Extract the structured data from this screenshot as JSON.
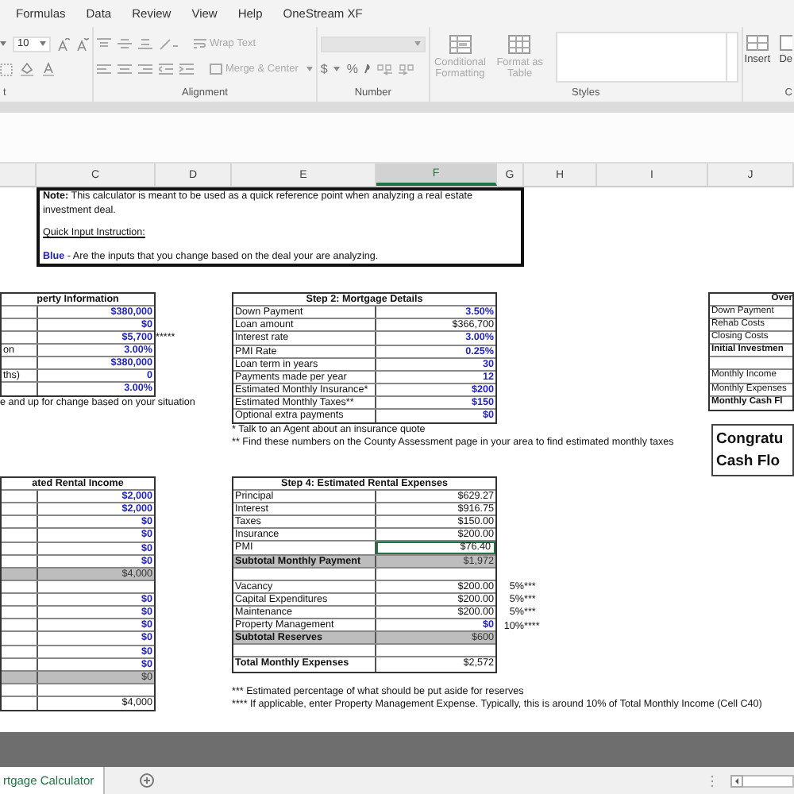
{
  "ribbon": {
    "tabs": [
      {
        "label": "Formulas",
        "selected": false
      },
      {
        "label": "Data",
        "selected": false
      },
      {
        "label": "Review",
        "selected": false
      },
      {
        "label": "View",
        "selected": false
      },
      {
        "label": "Help",
        "selected": false
      },
      {
        "label": "OneStream XF",
        "selected": false
      }
    ],
    "font_size": "10",
    "wrap_text": "Wrap Text",
    "merge_center": "Merge & Center",
    "currency": "$",
    "percent": "%",
    "conditional_formatting": "Conditional Formatting",
    "format_as_table": "Format as Table",
    "insert": "Insert",
    "delete": "De",
    "groups": [
      "t",
      "Alignment",
      "Number",
      "Styles",
      "C"
    ]
  },
  "columns": [
    {
      "letter": "C",
      "selected": false
    },
    {
      "letter": "D",
      "selected": false
    },
    {
      "letter": "E",
      "selected": false
    },
    {
      "letter": "F",
      "selected": true
    },
    {
      "letter": "G",
      "selected": false
    },
    {
      "letter": "H",
      "selected": false
    },
    {
      "letter": "I",
      "selected": false
    },
    {
      "letter": "J",
      "selected": false
    }
  ],
  "note": {
    "text": "**Note:** This calculator is meant to be used as a quick reference point when analyzing a real estate investment deal.",
    "instruction_title": "Quick Input Instruction:",
    "instruction": "**Blue** - Are the inputs that you change based on the deal your are analyzing."
  },
  "property": {
    "title": "perty Information",
    "rows": [
      {
        "value": "$380,000",
        "input": true
      },
      {
        "value": "$0",
        "input": true
      },
      {
        "value": "$5,700",
        "input": true,
        "mark": "*****"
      },
      {
        "label": "on",
        "value": "3.00%",
        "input": true
      },
      {
        "value": "$380,000",
        "input": true
      },
      {
        "label": "ths)",
        "value": "0",
        "input": true
      },
      {
        "value": "3.00%",
        "input": true
      }
    ],
    "footer": "e and up for change based on your situation"
  },
  "mortgage": {
    "title": "Step 2: Mortgage Details",
    "rows": [
      {
        "label": "Down Payment",
        "value": "3.50%",
        "input": true
      },
      {
        "label": "Loan amount",
        "value": "$366,700",
        "input": false
      },
      {
        "label": "Interest rate",
        "value": "3.00%",
        "input": true
      },
      {
        "label": "PMI Rate",
        "value": "0.25%",
        "input": true
      },
      {
        "label": "Loan term in years",
        "value": "30",
        "input": true
      },
      {
        "label": "Payments made per year",
        "value": "12",
        "input": true
      },
      {
        "label": "Estimated Monthly Insurance*",
        "value": "$200",
        "input": true
      },
      {
        "label": "Estimated Monthly Taxes**",
        "value": "$150",
        "input": true
      },
      {
        "label": "Optional extra payments",
        "value": "$0",
        "input": true
      }
    ],
    "notes": [
      "* Talk to an Agent about an insurance quote",
      "** Find these numbers on the County Assessment page in your area to find estimated monthly taxes"
    ]
  },
  "overview": {
    "title": "Over",
    "rows": [
      {
        "label": "Down Payment",
        "bold": false
      },
      {
        "label": "Rehab Costs",
        "bold": false
      },
      {
        "label": "Closing Costs",
        "bold": false
      },
      {
        "label": "Initial Investmen",
        "bold": true
      },
      {},
      {
        "label": "Monthly Income",
        "bold": false
      },
      {
        "label": "Monthly Expenses",
        "bold": false
      },
      {
        "label": "Monthly Cash Fl",
        "bold": true
      }
    ]
  },
  "cash_flow": [
    "Congratu",
    "Cash Flo"
  ],
  "income": {
    "title": "ated Rental Income",
    "rows": [
      {
        "kind": "input",
        "value": "$2,000"
      },
      {
        "kind": "input",
        "value": "$2,000"
      },
      {
        "kind": "input",
        "value": "$0"
      },
      {
        "kind": "input",
        "value": "$0"
      },
      {
        "kind": "input",
        "value": "$0"
      },
      {
        "kind": "input",
        "value": "$0"
      },
      {
        "kind": "subtotal",
        "value": "$4,000"
      },
      {
        "kind": "blank"
      },
      {
        "kind": "input",
        "value": "$0"
      },
      {
        "kind": "input",
        "value": "$0"
      },
      {
        "kind": "input",
        "value": "$0"
      },
      {
        "kind": "input",
        "value": "$0"
      },
      {
        "kind": "input",
        "value": "$0"
      },
      {
        "kind": "input",
        "value": "$0"
      },
      {
        "kind": "subtotal",
        "value": "$0"
      },
      {
        "kind": "blank"
      },
      {
        "kind": "calc",
        "value": "$4,000"
      }
    ]
  },
  "expenses": {
    "title": "Step 4: Estimated Rental Expenses",
    "rows": [
      {
        "kind": "calc",
        "label": "Principal",
        "value": "$629.27",
        "selected": false
      },
      {
        "kind": "calc",
        "label": "Interest",
        "value": "$916.75",
        "selected": false
      },
      {
        "kind": "calc",
        "label": "Taxes",
        "value": "$150.00",
        "selected": false
      },
      {
        "kind": "calc",
        "label": "Insurance",
        "value": "$200.00",
        "selected": false
      },
      {
        "kind": "calc",
        "label": "PMI",
        "value": "$76.40",
        "selected": true
      },
      {
        "kind": "subtotal",
        "label": "Subtotal Monthly Payment",
        "value": "$1,972",
        "selected": false
      },
      {
        "kind": "blank",
        "selected": false
      },
      {
        "kind": "calc",
        "label": "Vacancy",
        "value": "$200.00",
        "pct": "5%",
        "mark": "***",
        "selected": false
      },
      {
        "kind": "calc",
        "label": "Capital Expenditures",
        "value": "$200.00",
        "pct": "5%",
        "mark": "***",
        "selected": false
      },
      {
        "kind": "calc",
        "label": "Maintenance",
        "value": "$200.00",
        "pct": "5%",
        "mark": "***",
        "selected": false
      },
      {
        "kind": "input",
        "label": "Property Management",
        "value": "$0",
        "pct": "10%",
        "mark": "****",
        "selected": false
      },
      {
        "kind": "subtotal",
        "label": "Subtotal Reserves",
        "value": "$600",
        "selected": false
      },
      {
        "kind": "blank",
        "selected": false
      },
      {
        "kind": "total",
        "label": "Total Monthly Expenses",
        "value": "$2,572",
        "selected": false
      }
    ],
    "notes": [
      "*** Estimated percentage of what should be put aside for reserves",
      "**** If applicable, enter Property Management Expense. Typically, this is around 10% of Total Monthly Income (Cell C40)"
    ]
  },
  "sheet_tabs": [
    {
      "label": "rtgage Calculator",
      "selected": true
    }
  ]
}
